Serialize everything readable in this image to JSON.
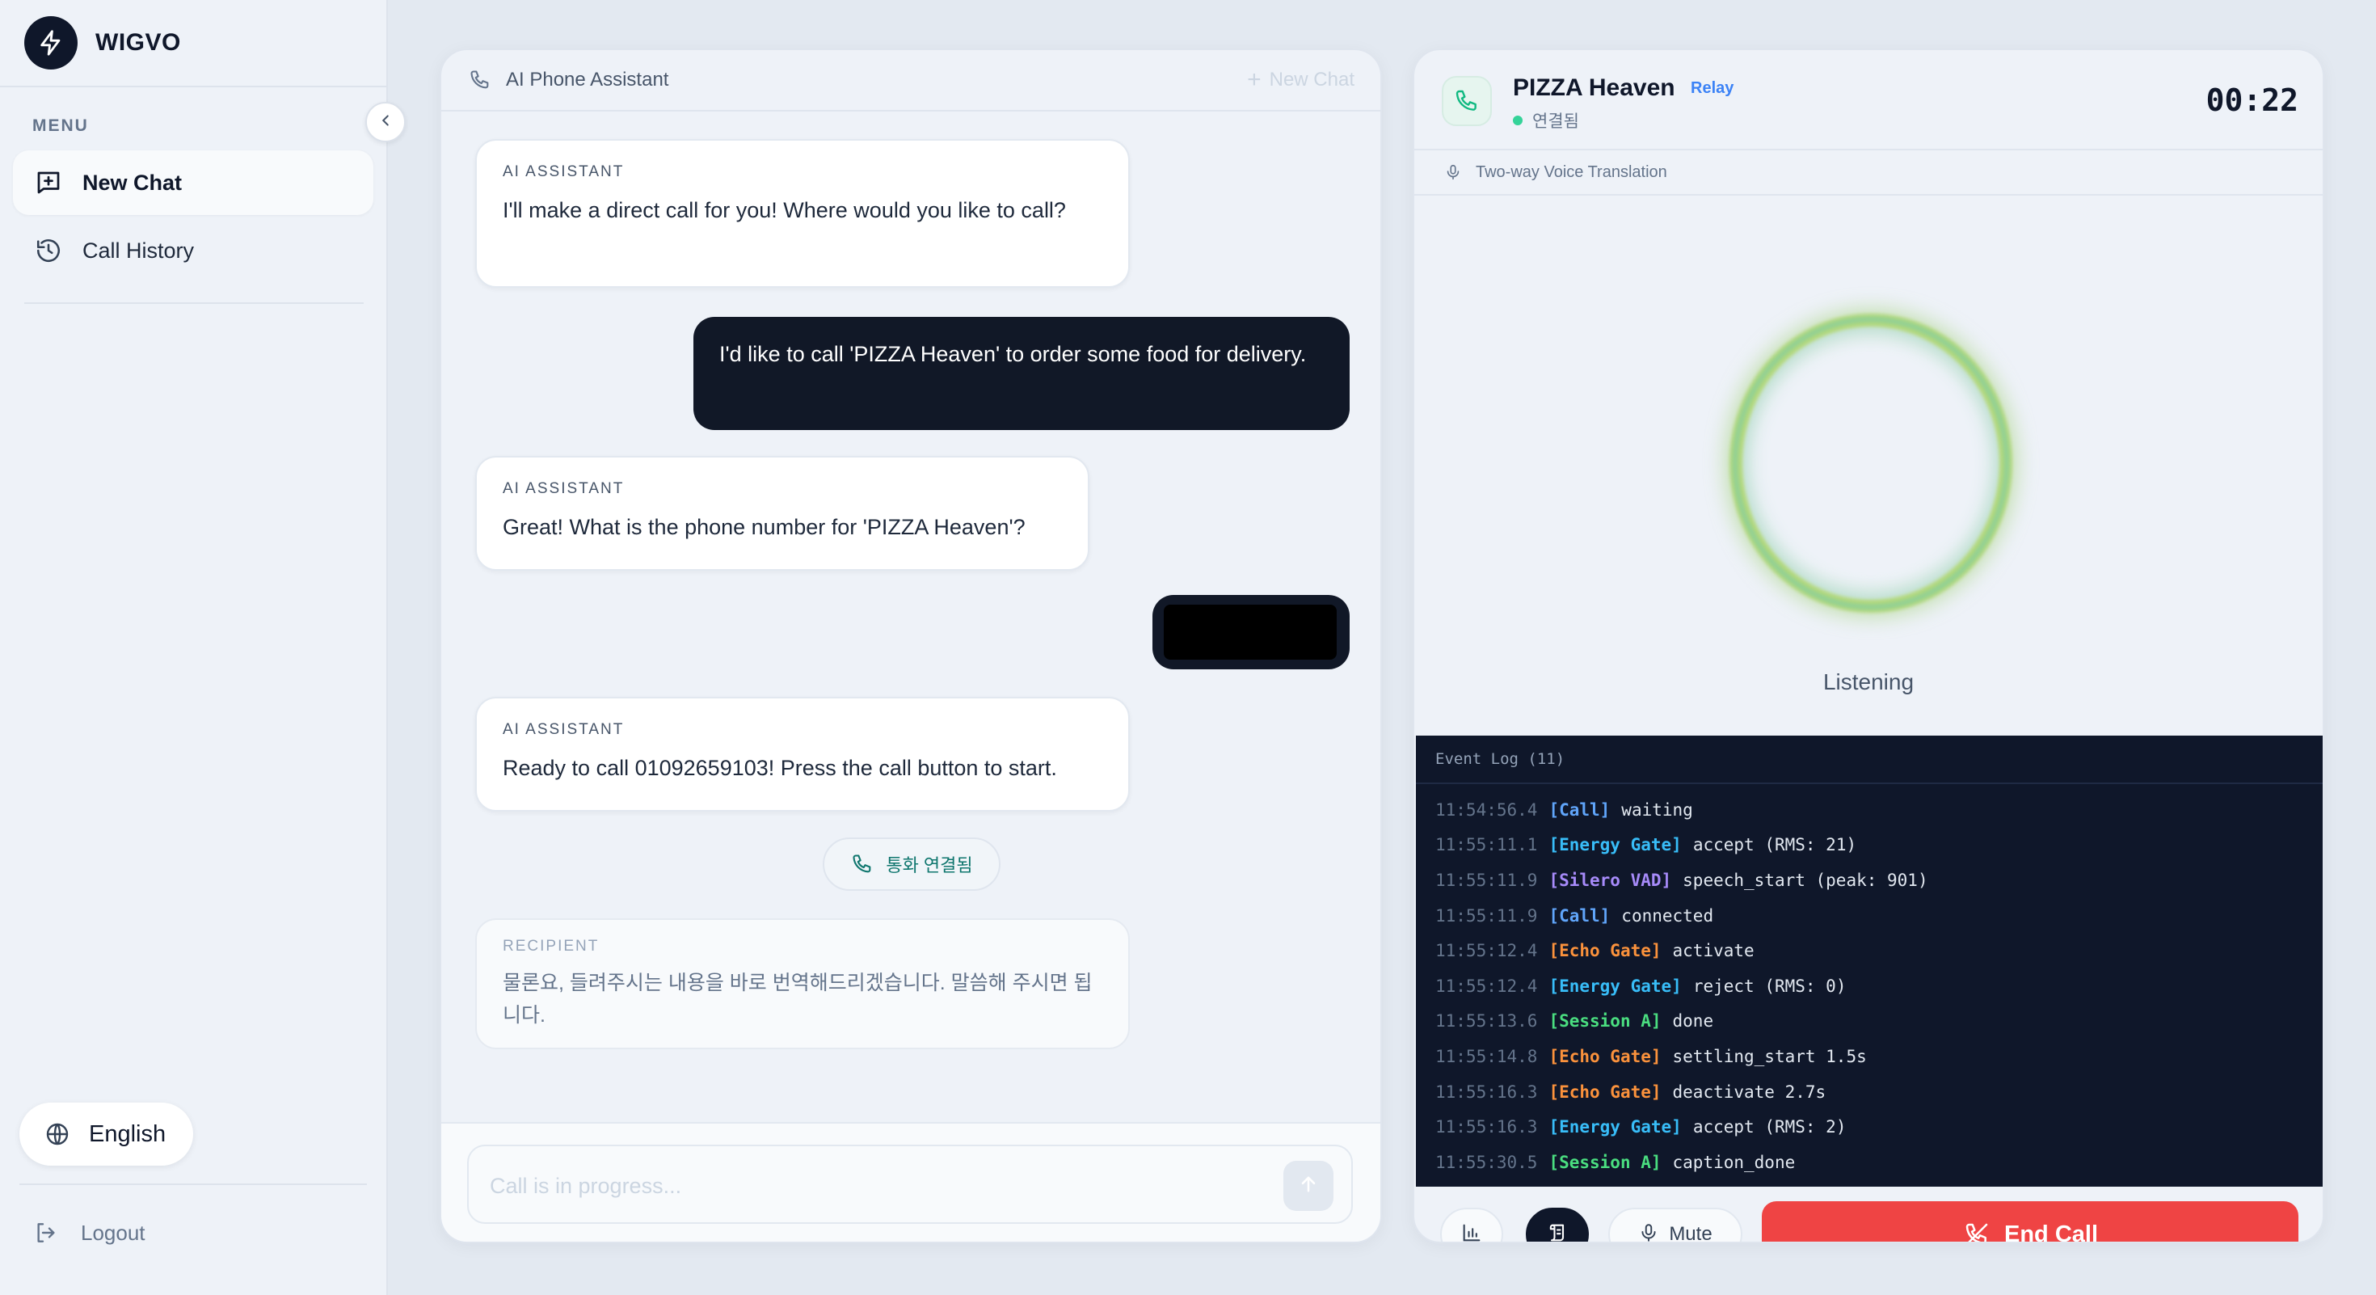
{
  "sidebar": {
    "brand": "WIGVO",
    "menu_label": "MENU",
    "items": [
      {
        "label": "New Chat",
        "icon": "message-plus-icon",
        "active": true
      },
      {
        "label": "Call History",
        "icon": "history-icon",
        "active": false
      }
    ],
    "language": "English",
    "logout": "Logout"
  },
  "chat": {
    "header_title": "AI Phone Assistant",
    "new_chat": "New Chat",
    "messages": [
      {
        "role": "ai",
        "who": "AI ASSISTANT",
        "text": "I'll make a direct call for you! Where would you like to call?"
      },
      {
        "role": "user",
        "text": "I'd like to call 'PIZZA Heaven' to order some food for delivery."
      },
      {
        "role": "ai",
        "who": "AI ASSISTANT",
        "text": "Great! What is the phone number for 'PIZZA Heaven'?"
      },
      {
        "role": "user",
        "text": "",
        "redacted": true
      },
      {
        "role": "ai",
        "who": "AI ASSISTANT",
        "text": "Ready to call 01092659103! Press the call button to start."
      },
      {
        "role": "recipient",
        "who": "RECIPIENT",
        "text": "물론요, 들려주시는 내용을 바로 번역해드리겠습니다. 말씀해 주시면 됩니다."
      }
    ],
    "call_chip": "통화 연결됨",
    "input_placeholder": "Call is in progress..."
  },
  "call": {
    "name": "PIZZA Heaven",
    "badge": "Relay",
    "status": "연결됨",
    "timer": "00:22",
    "mode": "Two-way Voice Translation",
    "state": "Listening",
    "event_log_title": "Event Log (11)",
    "events": [
      {
        "time": "11:54:56.4",
        "tag": "[Call]",
        "color": "#60a5fa",
        "msg": "waiting"
      },
      {
        "time": "11:55:11.1",
        "tag": "[Energy Gate]",
        "color": "#38bdf8",
        "msg": "accept (RMS: 21)"
      },
      {
        "time": "11:55:11.9",
        "tag": "[Silero VAD]",
        "color": "#a78bfa",
        "msg": "speech_start (peak: 901)"
      },
      {
        "time": "11:55:11.9",
        "tag": "[Call]",
        "color": "#60a5fa",
        "msg": "connected"
      },
      {
        "time": "11:55:12.4",
        "tag": "[Echo Gate]",
        "color": "#fb923c",
        "msg": "activate"
      },
      {
        "time": "11:55:12.4",
        "tag": "[Energy Gate]",
        "color": "#38bdf8",
        "msg": "reject (RMS: 0)"
      },
      {
        "time": "11:55:13.6",
        "tag": "[Session A]",
        "color": "#4ade80",
        "msg": "done"
      },
      {
        "time": "11:55:14.8",
        "tag": "[Echo Gate]",
        "color": "#fb923c",
        "msg": "settling_start 1.5s"
      },
      {
        "time": "11:55:16.3",
        "tag": "[Echo Gate]",
        "color": "#fb923c",
        "msg": "deactivate 2.7s"
      },
      {
        "time": "11:55:16.3",
        "tag": "[Energy Gate]",
        "color": "#38bdf8",
        "msg": "accept (RMS: 2)"
      },
      {
        "time": "11:55:30.5",
        "tag": "[Session A]",
        "color": "#4ade80",
        "msg": "caption_done"
      }
    ],
    "mute_label": "Mute",
    "end_call_label": "End Call"
  },
  "colors": {
    "accent_dark": "#0f172a",
    "end_call": "#ef4444",
    "connected": "#34d399",
    "relay": "#3b82f6"
  }
}
